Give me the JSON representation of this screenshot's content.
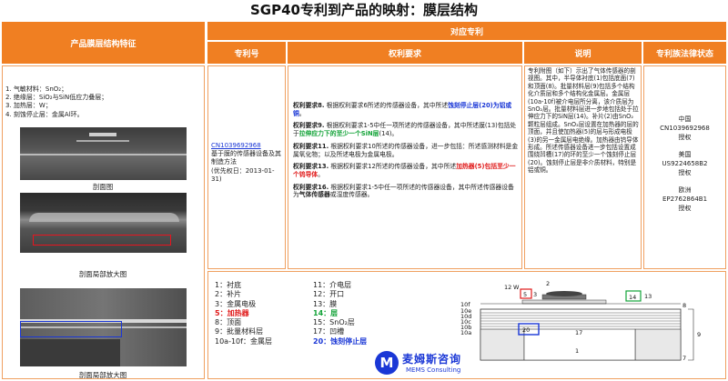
{
  "title": "SGP40专利到产品的映射：膜层结构",
  "header": {
    "left": "产品膜层结构特征",
    "group": "对应专利",
    "col_patent": "专利号",
    "col_claims": "权利要求",
    "col_desc": "说明",
    "col_status": "专利族法律状态"
  },
  "features": [
    "1. 气敏材料：SnO₂；",
    "2. 绝缘层：SiO₂与SiN低应力叠层；",
    "3. 加热层：W；",
    "4. 刻蚀停止层：金属Al环。"
  ],
  "captions": {
    "cross_section": "剖面图",
    "partial1": "剖面局部放大图",
    "partial2": "剖面局部放大图"
  },
  "patent": {
    "number": "CN1039692968",
    "title": "基于膜的传感器设备及其制造方法",
    "priority": "(优先权日：2013-01-31)"
  },
  "claims": [
    {
      "label": "权利要求8.",
      "text": " 根据权利要求6所述的传感器设备，其中所述",
      "hl": "蚀刻停止层(20)为铝或铜",
      "tail": "。",
      "hl_color": "blue"
    },
    {
      "label": "权利要求9.",
      "text": " 根据权利要求1-5中任一项所述的传感器设备，其中所述膜(13)包括处于",
      "hl": "拉伸应力下的至少一个SiN层",
      "tail": "(14)。",
      "hl_color": "green"
    },
    {
      "label": "权利要求11.",
      "text": " 根据权利要求10所述的传感器设备，进一步包括：所述感测材料是金属氧化物；以及所述电极为金属电极。",
      "hl": "",
      "tail": "",
      "hl_color": ""
    },
    {
      "label": "权利要求13.",
      "text": " 根据权利要求12所述的传感器设备，其中所述",
      "hl": "加热器(5)包括至少一个钨导体",
      "tail": "。",
      "hl_color": "red"
    },
    {
      "label": "权利要求16.",
      "text": " 根据权利要求1-5中任一项所述的传感器设备，其中所述传感器设备为",
      "hl": "气体传感器",
      "tail": "或湿度传感器。",
      "hl_color": "black"
    }
  ],
  "description": "专利附图（如下）示出了气体传感器的剖视图。其中，半导体衬底(1)包括底面(7)和顶面(8)。批量材料层(9)包括多个结构化介质层和多个结构化金属层。金属层(10a-10f)被介电层所分离，该介质层为SnO₂层。批量材料层进一步地包括处于拉伸应力下的SiN层(14)。补片(2)由SnO₂颗粒层组成。SnO₂层设置在加热器的层的顶面，并且使加热器(5)的层与形成电极(3)的另一金属层电绝缘。加热器由钨导体形成。所述传感器设备进一步包括设置成围绕凹槽(17)的环的至少一个蚀刻停止层(20)。蚀刻停止层是非介质材料，特别是铝或铜。",
  "status": [
    {
      "region": "中国",
      "number": "CN1039692968",
      "state": "授权"
    },
    {
      "region": "美国",
      "number": "US9224658B2",
      "state": "授权"
    },
    {
      "region": "欧洲",
      "number": "EP2762864B1",
      "state": "授权"
    }
  ],
  "legend_left": [
    {
      "text": "1：衬底",
      "color": "black"
    },
    {
      "text": "2：补片",
      "color": "black"
    },
    {
      "text": "3：金属电极",
      "color": "black"
    },
    {
      "text": "5：加热器",
      "color": "red"
    },
    {
      "text": "8：顶面",
      "color": "black"
    },
    {
      "text": "9：批量材料层",
      "color": "black"
    },
    {
      "text": "10a-10f：金属层",
      "color": "black"
    }
  ],
  "legend_right": [
    {
      "text": "11：介电层",
      "color": "black"
    },
    {
      "text": "12：开口",
      "color": "black"
    },
    {
      "text": "13：膜",
      "color": "black"
    },
    {
      "text": "14：层",
      "color": "green"
    },
    {
      "text": "15：SnO₂层",
      "color": "black"
    },
    {
      "text": "17：凹槽",
      "color": "black"
    },
    {
      "text": "20：蚀刻停止层",
      "color": "blue"
    }
  ],
  "drawing_labels": {
    "n1": "1",
    "n3": "3",
    "n5": "5",
    "n7": "7",
    "n8": "8",
    "n9": "9",
    "n10f": "10f",
    "n10e": "10e",
    "n10d": "10d",
    "n10c": "10c",
    "n10b": "10b",
    "n10a": "10a",
    "n12": "12",
    "n13": "13",
    "n14": "14",
    "n17": "17",
    "n20": "20",
    "w": "W",
    "h": "2"
  },
  "logo": {
    "name_cn": "麦姆斯咨询",
    "name_en": "MEMS Consulting",
    "mark": "M"
  }
}
